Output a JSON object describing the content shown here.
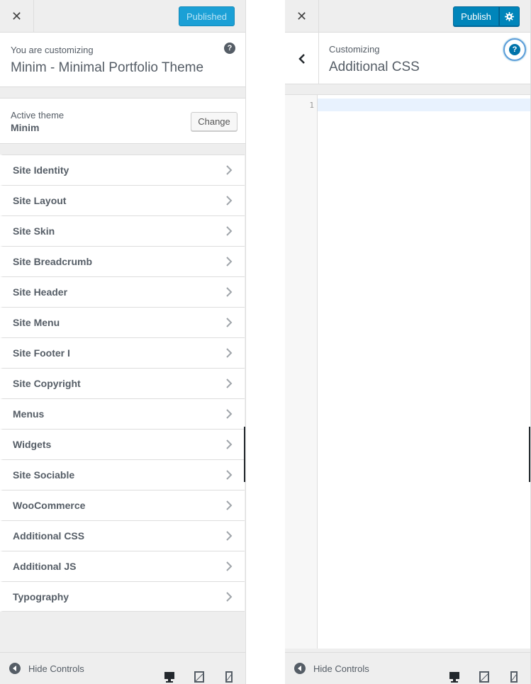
{
  "left": {
    "close_symbol": "✕",
    "publish_status": "Published",
    "info": {
      "subtitle": "You are customizing",
      "title": "Minim - Minimal Portfolio Theme",
      "help_symbol": "?"
    },
    "theme": {
      "subtitle": "Active theme",
      "name": "Minim",
      "change_label": "Change"
    },
    "menu": [
      {
        "label": "Site Identity"
      },
      {
        "label": "Site Layout"
      },
      {
        "label": "Site Skin"
      },
      {
        "label": "Site Breadcrumb"
      },
      {
        "label": "Site Header"
      },
      {
        "label": "Site Menu"
      },
      {
        "label": "Site Footer I"
      },
      {
        "label": "Site Copyright"
      },
      {
        "label": "Menus"
      },
      {
        "label": "Widgets"
      },
      {
        "label": "Site Sociable"
      },
      {
        "label": "WooCommerce"
      },
      {
        "label": "Additional CSS"
      },
      {
        "label": "Additional JS"
      },
      {
        "label": "Typography"
      }
    ],
    "footer": {
      "hide_label": "Hide Controls"
    }
  },
  "right": {
    "close_symbol": "✕",
    "publish_label": "Publish",
    "settings_icon": "gear-icon",
    "section": {
      "subtitle": "Customizing",
      "title": "Additional CSS",
      "help_symbol": "?"
    },
    "editor": {
      "line_numbers": [
        "1"
      ],
      "content": ""
    },
    "footer": {
      "hide_label": "Hide Controls"
    }
  },
  "colors": {
    "primary": "#0085ba",
    "published": "#1ba0d6",
    "panel_bg": "#eeeeee",
    "text": "#555d66"
  }
}
